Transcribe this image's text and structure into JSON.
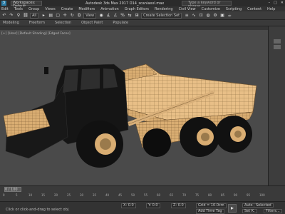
{
  "titlebar": {
    "workspace": "Workspaces: Default",
    "title": "Autodesk 3ds Max 2017    D14_scaniaxxl.max",
    "search_placeholder": "Type a keyword or phrase",
    "win_min": "–",
    "win_max": "□",
    "win_close": "✕"
  },
  "menubar": [
    "Edit",
    "Tools",
    "Group",
    "Views",
    "Create",
    "Modifiers",
    "Animation",
    "Graph Editors",
    "Rendering",
    "Civil View",
    "Customize",
    "Scripting",
    "Content",
    "Help"
  ],
  "toolbar": {
    "filter_value": "All",
    "view_value": "View",
    "selection_set_placeholder": "Create Selection Set"
  },
  "ribbon": [
    "Modeling",
    "Freeform",
    "Selection",
    "Object Paint",
    "Populate"
  ],
  "viewport": {
    "label": "[+] [User] [Default Shading] [Edged Faces]"
  },
  "timeline": {
    "frame": "0 / 100",
    "ticks": [
      "0",
      "5",
      "10",
      "15",
      "20",
      "25",
      "30",
      "35",
      "40",
      "45",
      "50",
      "55",
      "60",
      "65",
      "70",
      "75",
      "80",
      "85",
      "90",
      "95",
      "100"
    ]
  },
  "status": {
    "text": "Click or click-and-drag to select obj",
    "x_value": "X: 0.0",
    "y_value": "Y: 0.0",
    "z_value": "Z: 0.0",
    "grid": "Grid = 10.0cm",
    "add_time_tag": "Add Time Tag",
    "auto_key": "Auto Key",
    "set_key": "Set K.",
    "selected": "Selected",
    "filters": "Filters..."
  },
  "colors": {
    "bg": "#4a4a4a",
    "truck_body": "#151515",
    "wire": "#f0c890"
  }
}
